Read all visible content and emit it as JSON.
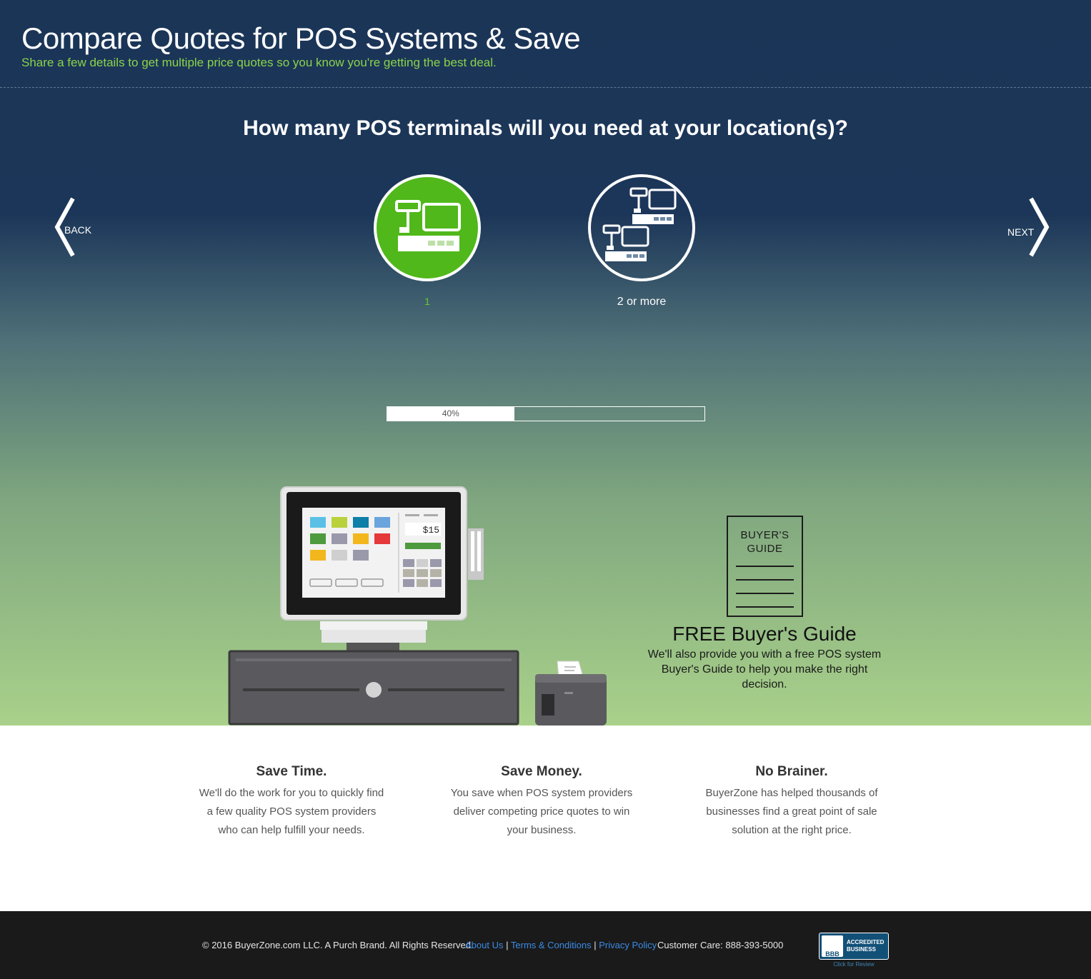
{
  "header": {
    "title": "Compare Quotes for POS Systems & Save",
    "subtitle": "Share a few details to get multiple price quotes so you know you're getting the best deal."
  },
  "question": "How many POS terminals will you need at your location(s)?",
  "nav": {
    "back_label": "BACK",
    "next_label": "NEXT"
  },
  "options": [
    {
      "label": "1",
      "icon": "single-terminal-icon",
      "selected": true
    },
    {
      "label": "2 or more",
      "icon": "multiple-terminals-icon",
      "selected": false
    }
  ],
  "progress": {
    "percent_text": "40%",
    "value": 0.4
  },
  "illustration": {
    "price_display": "$15"
  },
  "guide": {
    "book_title": "BUYER'S GUIDE",
    "heading": "FREE Buyer's Guide",
    "text": "We'll also provide you with a free POS system Buyer's Guide to help you make the right decision."
  },
  "benefits": [
    {
      "title": "Save Time.",
      "text": "We'll do the work for you to quickly find a few quality POS system providers who can help fulfill your needs."
    },
    {
      "title": "Save Money.",
      "text": "You save when POS system providers deliver competing price quotes to win your business."
    },
    {
      "title": "No Brainer.",
      "text": "BuyerZone has helped thousands of businesses find a great point of sale solution at the right price."
    }
  ],
  "footer": {
    "copyright": "© 2016 BuyerZone.com LLC. A Purch Brand. All Rights Reserved.",
    "links": [
      "About Us",
      "Terms & Conditions",
      "Privacy Policy"
    ],
    "separator": "|",
    "customer_care": "Customer Care: 888-393-5000",
    "bbb": {
      "seal": "BBB",
      "line1": "ACCREDITED",
      "line2": "BUSINESS",
      "review": "Click for Review"
    }
  },
  "colors": {
    "accent_green": "#50b81a",
    "header_navy": "#1b3557",
    "link_blue": "#3a8be6"
  }
}
